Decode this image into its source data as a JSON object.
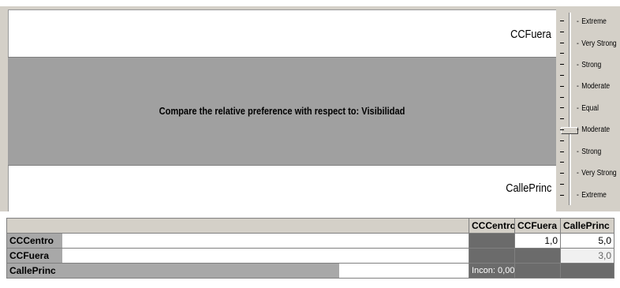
{
  "comparison": {
    "top_alternative": "CCFuera",
    "bottom_alternative": "CallePrinc",
    "question": "Compare the relative preference with respect to: Visibilidad"
  },
  "scale": {
    "levels": [
      "Extreme",
      "Very Strong",
      "Strong",
      "Moderate",
      "Equal",
      "Moderate",
      "Strong",
      "Very Strong",
      "Extreme"
    ],
    "selected_index": 5
  },
  "matrix": {
    "headers": [
      "",
      "CCCentro",
      "CCFuera",
      "CallePrinc"
    ],
    "rows": [
      {
        "name": "CCCentro",
        "bar": 0.12,
        "cells": [
          "",
          "1,0",
          "5,0"
        ]
      },
      {
        "name": "CCFuera",
        "bar": 0.12,
        "cells": [
          "",
          "",
          "3,0"
        ]
      },
      {
        "name": "CallePrinc",
        "bar": 0.72,
        "cells": [
          "Incon: 0,00",
          "",
          ""
        ]
      }
    ]
  }
}
